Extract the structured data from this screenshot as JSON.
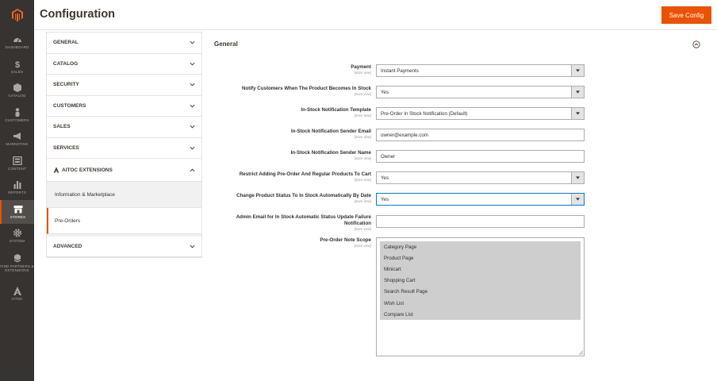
{
  "header": {
    "title": "Configuration",
    "save_label": "Save Config"
  },
  "admin_nav": [
    {
      "label": "Dashboard",
      "icon": "dashboard-icon"
    },
    {
      "label": "Sales",
      "icon": "dollar-icon"
    },
    {
      "label": "Catalog",
      "icon": "box-icon"
    },
    {
      "label": "Customers",
      "icon": "person-icon"
    },
    {
      "label": "Marketing",
      "icon": "megaphone-icon"
    },
    {
      "label": "Content",
      "icon": "layout-icon"
    },
    {
      "label": "Reports",
      "icon": "bar-chart-icon"
    },
    {
      "label": "Stores",
      "icon": "store-icon"
    },
    {
      "label": "System",
      "icon": "gear-icon"
    },
    {
      "label": "Find Partners & Extensions",
      "icon": "cubes-icon"
    },
    {
      "label": "Aitoc",
      "icon": "aitoc-logo-icon"
    }
  ],
  "config_tabs": {
    "general": "GENERAL",
    "catalog": "CATALOG",
    "security": "SECURITY",
    "customers": "CUSTOMERS",
    "sales": "SALES",
    "services": "SERVICES",
    "aitoc": "AITOC EXTENSIONS",
    "aitoc_items": [
      "Information & Marketplace",
      "Pre-Orders"
    ],
    "advanced": "ADVANCED"
  },
  "section": {
    "title": "General"
  },
  "scope_label": "[store view]",
  "fields": {
    "payment": {
      "label": "Payment",
      "value": "Instant Payments"
    },
    "notify": {
      "label": "Notify Customers When The Product Becomes In Stock",
      "value": "Yes"
    },
    "template": {
      "label": "In-Stock Notification Template",
      "value": "Pre-Order In Stock Notification (Default)"
    },
    "sender_email": {
      "label": "In-Stock Notification Sender Email",
      "value": "owner@example.com"
    },
    "sender_name": {
      "label": "In-Stock Notification Sender Name",
      "value": "Owner"
    },
    "restrict": {
      "label": "Restrict Adding Pre-Order And Regular Products To Cart",
      "value": "Yes"
    },
    "change_status": {
      "label": "Change Product Status To In Stock Automatically By Date",
      "value": "Yes"
    },
    "admin_email": {
      "label": "Admin Email for In Stock Automatic Status Update Failure Notification",
      "value": ""
    },
    "note_scope": {
      "label": "Pre-Order Note Scope",
      "options": [
        "Category Page",
        "Product Page",
        "Minicart",
        "Shopping Cart",
        "Search Result Page",
        "Wish List",
        "Compare List"
      ]
    }
  }
}
